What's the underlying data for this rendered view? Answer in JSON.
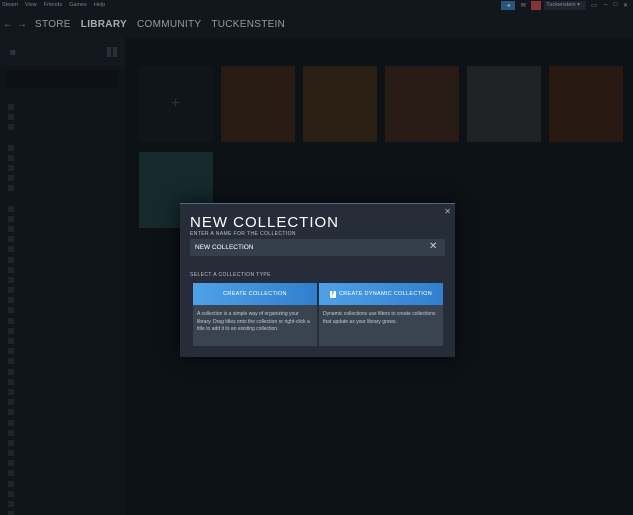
{
  "titlebar": {
    "menu": [
      "Steam",
      "View",
      "Friends",
      "Games",
      "Help"
    ],
    "username": "Tuckenstein",
    "window_controls": [
      "minimize",
      "maximize",
      "close"
    ]
  },
  "nav": {
    "links": [
      {
        "label": "STORE",
        "active": false
      },
      {
        "label": "LIBRARY",
        "active": true
      },
      {
        "label": "COMMUNITY",
        "active": false
      },
      {
        "label": "TUCKENSTEIN",
        "active": false
      }
    ]
  },
  "modal": {
    "title": "NEW COLLECTION",
    "name_label": "ENTER A NAME FOR THE COLLECTION",
    "name_value": "NEW COLLECTION",
    "type_label": "SELECT A COLLECTION TYPE",
    "options": [
      {
        "button": "CREATE COLLECTION",
        "description": "A collection is a simple way of organizing your library. Drag titles onto the collection or right-click a title to add it to an existing collection."
      },
      {
        "button": "CREATE DYNAMIC COLLECTION",
        "description": "Dynamic collections use filters to create collections that update as your library grows."
      }
    ]
  },
  "colors": {
    "accent": "#3b7fb6",
    "modal_bg": "#262d38",
    "button_gradient_start": "#4da2e8",
    "button_gradient_end": "#2f7fce"
  }
}
